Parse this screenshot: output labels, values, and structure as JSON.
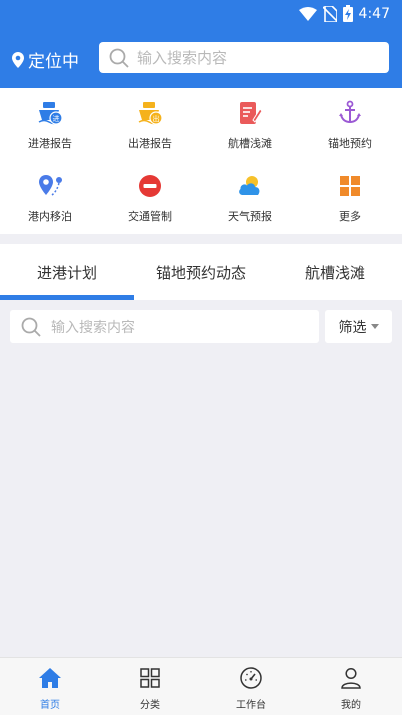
{
  "status_bar": {
    "time": "4:47"
  },
  "header": {
    "location": "定位中",
    "search_placeholder": "输入搜索内容"
  },
  "quick_grid": [
    {
      "label": "进港报告",
      "icon": "ship-in-icon",
      "color": "#2f7de6"
    },
    {
      "label": "出港报告",
      "icon": "ship-out-icon",
      "color": "#f5b21c"
    },
    {
      "label": "航槽浅滩",
      "icon": "channel-note-icon",
      "color": "#ea5a5a"
    },
    {
      "label": "锚地预约",
      "icon": "anchor-icon",
      "color": "#9b59d4"
    },
    {
      "label": "港内移泊",
      "icon": "route-pin-icon",
      "color": "#4a7be8"
    },
    {
      "label": "交通管制",
      "icon": "no-entry-icon",
      "color": "#e53935"
    },
    {
      "label": "天气预报",
      "icon": "weather-cloud-icon",
      "color": "#2f93e8"
    },
    {
      "label": "更多",
      "icon": "more-grid-icon",
      "color": "#f08a2a"
    }
  ],
  "tabs": [
    {
      "label": "进港计划",
      "active": true
    },
    {
      "label": "锚地预约动态",
      "active": false
    },
    {
      "label": "航槽浅滩",
      "active": false
    }
  ],
  "filter_bar": {
    "search_placeholder": "输入搜索内容",
    "filter_label": "筛选"
  },
  "bottom_nav": [
    {
      "label": "首页",
      "icon": "home-icon",
      "active": true
    },
    {
      "label": "分类",
      "icon": "category-grid-icon",
      "active": false
    },
    {
      "label": "工作台",
      "icon": "dashboard-gauge-icon",
      "active": false
    },
    {
      "label": "我的",
      "icon": "user-icon",
      "active": false
    }
  ],
  "colors": {
    "primary": "#2f7de6",
    "background": "#efeff4"
  }
}
